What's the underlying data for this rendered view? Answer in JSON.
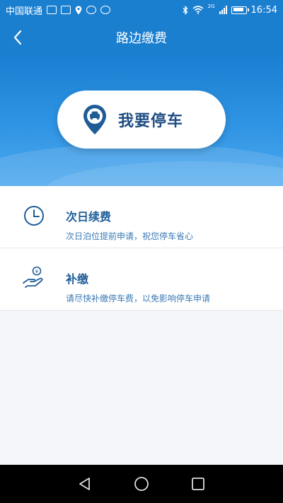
{
  "status_bar": {
    "carrier": "中国联通",
    "network": "2G",
    "time": "16:54",
    "icons": [
      "image-icon",
      "notification-icon",
      "location-icon",
      "app-icon",
      "message-icon",
      "bluetooth-icon",
      "wifi-icon",
      "signal-icon",
      "battery-icon"
    ]
  },
  "nav": {
    "title": "路边缴费",
    "back_icon": "chevron-left-icon"
  },
  "hero": {
    "button_label": "我要停车",
    "button_icon": "car-location-pin-icon"
  },
  "list": [
    {
      "title": "次日续费",
      "subtitle": "次日泊位提前申请，祝您停车省心",
      "icon": "clock-icon"
    },
    {
      "title": "补缴",
      "subtitle": "请尽快补缴停车费，以免影响停车申请",
      "icon": "hand-coin-icon"
    }
  ],
  "colors": {
    "primary": "#1b7fd0",
    "accent_text": "#1f5d97",
    "background": "#f4f6f9"
  },
  "system_nav": [
    "back-triangle-icon",
    "home-circle-icon",
    "recents-square-icon"
  ]
}
